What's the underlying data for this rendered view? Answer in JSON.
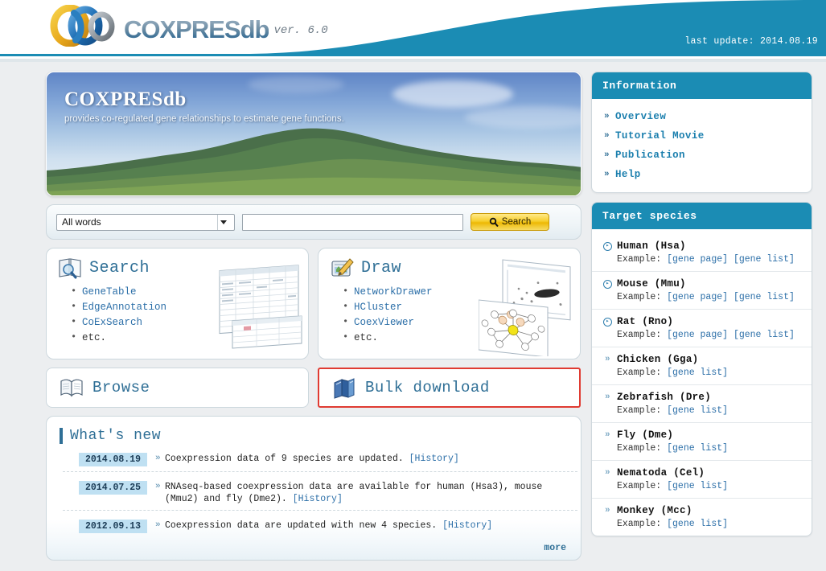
{
  "header": {
    "logo_word": "COXPRESdb",
    "version": "ver. 6.0",
    "last_update": "last update: 2014.08.19",
    "logo_icon": "interlocking-rings-logo"
  },
  "banner": {
    "title": "COXPRESdb",
    "subtitle": "provides co-regulated gene relationships to estimate gene functions."
  },
  "search": {
    "selected_option": "All words",
    "options": [
      "All words"
    ],
    "input_value": "",
    "placeholder": "",
    "button_label": "Search",
    "button_icon": "magnifier-icon",
    "dropdown_icon": "chevron-down-icon"
  },
  "features": [
    {
      "title": "Search",
      "icon": "book-magnifier-icon",
      "thumb": "spreadsheet-thumbnail",
      "items": [
        "GeneTable",
        "EdgeAnnotation",
        "CoExSearch",
        "etc."
      ]
    },
    {
      "title": "Draw",
      "icon": "pencil-notepad-icon",
      "thumb": "network-graph-thumbnail",
      "items": [
        "NetworkDrawer",
        "HCluster",
        "CoexViewer",
        "etc."
      ]
    }
  ],
  "actions": [
    {
      "title": "Browse",
      "icon": "open-book-icon",
      "highlighted": false
    },
    {
      "title": "Bulk download",
      "icon": "stacked-books-icon",
      "highlighted": true
    }
  ],
  "news": {
    "title": "What's new",
    "more_label": "more",
    "history_label": "[History]",
    "items": [
      {
        "date": "2014.08.19",
        "text": "Coexpression data of 9 species are updated.",
        "link": "[History]"
      },
      {
        "date": "2014.07.25",
        "text": "RNAseq-based coexpression data are available for human (Hsa3), mouse (Mmu2) and fly (Dme2).",
        "link": "[History]"
      },
      {
        "date": "2012.09.13",
        "text": "Coexpression data are updated with new 4 species.",
        "link": "[History]"
      }
    ]
  },
  "information": {
    "title": "Information",
    "items": [
      {
        "label": "Overview"
      },
      {
        "label": "Tutorial Movie"
      },
      {
        "label": "Publication"
      },
      {
        "label": "Help"
      }
    ]
  },
  "target_species": {
    "title": "Target species",
    "example_label": "Example:",
    "items": [
      {
        "name": "Human (Hsa)",
        "marker": "circle",
        "links": [
          "[gene page]",
          "[gene list]"
        ]
      },
      {
        "name": "Mouse (Mmu)",
        "marker": "circle",
        "links": [
          "[gene page]",
          "[gene list]"
        ]
      },
      {
        "name": "Rat (Rno)",
        "marker": "circle",
        "links": [
          "[gene page]",
          "[gene list]"
        ]
      },
      {
        "name": "Chicken (Gga)",
        "marker": "arrow",
        "links": [
          "[gene list]"
        ]
      },
      {
        "name": "Zebrafish (Dre)",
        "marker": "arrow",
        "links": [
          "[gene list]"
        ]
      },
      {
        "name": "Fly (Dme)",
        "marker": "arrow",
        "links": [
          "[gene list]"
        ]
      },
      {
        "name": "Nematoda (Cel)",
        "marker": "arrow",
        "links": [
          "[gene list]"
        ]
      },
      {
        "name": "Monkey (Mcc)",
        "marker": "arrow",
        "links": [
          "[gene list]"
        ]
      }
    ]
  },
  "colors": {
    "brand_teal": "#1b8cb4",
    "link_blue": "#2c6fa8",
    "heading_blue": "#2f6f96",
    "highlight_red": "#e03b32",
    "date_badge": "#bfe0f2",
    "page_bg": "#eceef0"
  }
}
